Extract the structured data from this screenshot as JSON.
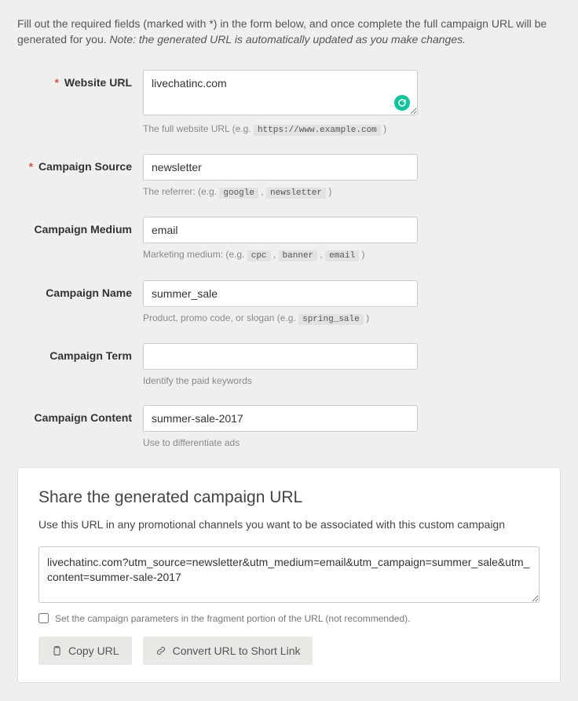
{
  "intro": {
    "text_a": "Fill out the required fields (marked with *) in the form below, and once complete the full campaign URL will be generated for you. ",
    "note": "Note: the generated URL is automatically updated as you make changes."
  },
  "fields": {
    "website_url": {
      "label": "Website URL",
      "required": true,
      "value": "livechatinc.com",
      "help_prefix": "The full website URL (e.g. ",
      "help_code": "https://www.example.com",
      "help_suffix": " )"
    },
    "campaign_source": {
      "label": "Campaign Source",
      "required": true,
      "value": "newsletter",
      "help_prefix": "The referrer: (e.g. ",
      "help_code1": "google",
      "help_sep": " , ",
      "help_code2": "newsletter",
      "help_suffix": " )"
    },
    "campaign_medium": {
      "label": "Campaign Medium",
      "required": false,
      "value": "email",
      "help_prefix": "Marketing medium: (e.g. ",
      "help_code1": "cpc",
      "help_sep": " , ",
      "help_code2": "banner",
      "help_code3": "email",
      "help_suffix": " )"
    },
    "campaign_name": {
      "label": "Campaign Name",
      "required": false,
      "value": "summer_sale",
      "help_prefix": "Product, promo code, or slogan (e.g. ",
      "help_code": "spring_sale",
      "help_suffix": " )"
    },
    "campaign_term": {
      "label": "Campaign Term",
      "required": false,
      "value": "",
      "help": "Identify the paid keywords"
    },
    "campaign_content": {
      "label": "Campaign Content",
      "required": false,
      "value": "summer-sale-2017",
      "help": "Use to differentiate ads"
    }
  },
  "share": {
    "title": "Share the generated campaign URL",
    "description": "Use this URL in any promotional channels you want to be associated with this custom campaign",
    "generated_url": "livechatinc.com?utm_source=newsletter&utm_medium=email&utm_campaign=summer_sale&utm_content=summer-sale-2017",
    "fragment_checkbox_label": "Set the campaign parameters in the fragment portion of the URL (not recommended).",
    "copy_button": "Copy URL",
    "convert_button": "Convert URL to Short Link"
  }
}
